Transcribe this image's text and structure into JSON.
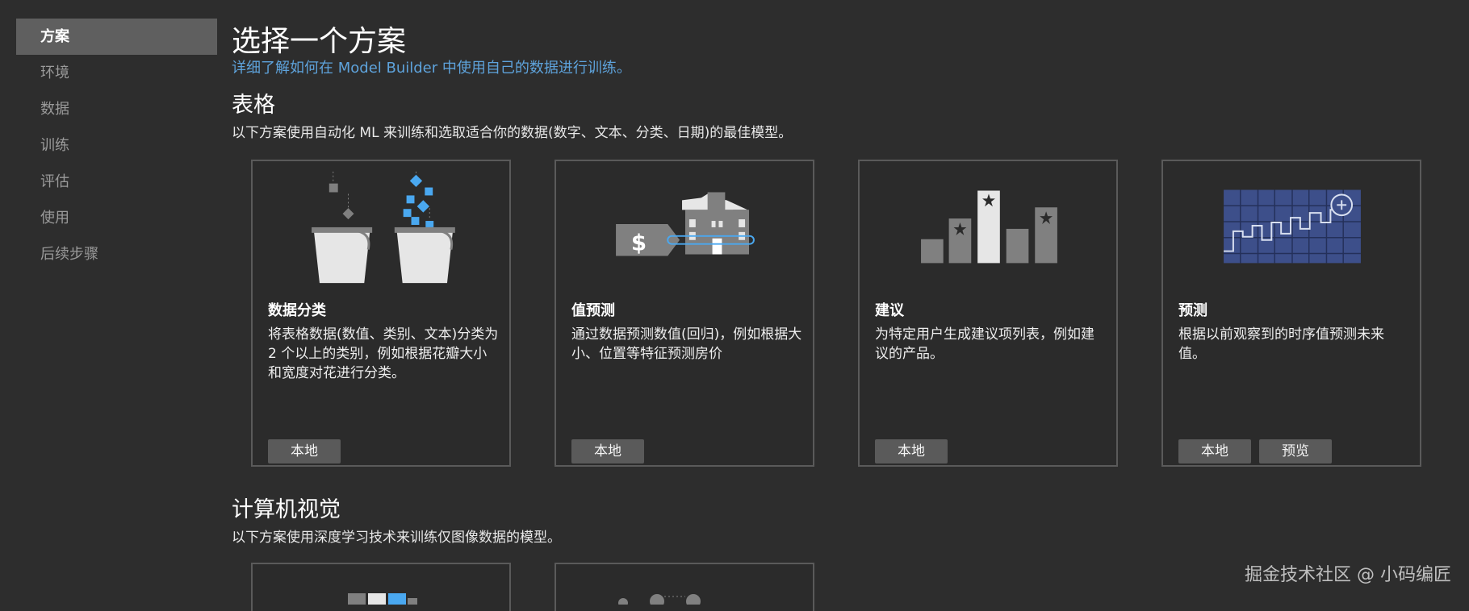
{
  "sidebar": {
    "items": [
      {
        "label": "方案",
        "active": true
      },
      {
        "label": "环境",
        "active": false
      },
      {
        "label": "数据",
        "active": false
      },
      {
        "label": "训练",
        "active": false
      },
      {
        "label": "评估",
        "active": false
      },
      {
        "label": "使用",
        "active": false
      },
      {
        "label": "后续步骤",
        "active": false
      }
    ]
  },
  "main": {
    "title": "选择一个方案",
    "learn_more_link": "详细了解如何在 Model Builder 中使用自己的数据进行训练。",
    "sections": [
      {
        "title": "表格",
        "description": "以下方案使用自动化 ML 来训练和选取适合你的数据(数字、文本、分类、日期)的最佳模型。",
        "cards": [
          {
            "title": "数据分类",
            "description": "将表格数据(数值、类别、文本)分类为 2 个以上的类别，例如根据花瓣大小和宽度对花进行分类。",
            "tags": [
              "本地"
            ]
          },
          {
            "title": "值预测",
            "description": "通过数据预测数值(回归)，例如根据大小、位置等特征预测房价",
            "tags": [
              "本地"
            ]
          },
          {
            "title": "建议",
            "description": "为特定用户生成建议项列表，例如建议的产品。",
            "tags": [
              "本地"
            ]
          },
          {
            "title": "预测",
            "description": "根据以前观察到的时序值预测未来值。",
            "tags": [
              "本地",
              "预览"
            ]
          }
        ]
      },
      {
        "title": "计算机视觉",
        "description": "以下方案使用深度学习技术来训练仅图像数据的模型。"
      }
    ]
  },
  "illustration_colors": {
    "gray": "#808080",
    "light": "#e6e6e6",
    "accent_blue": "#4aa8f0",
    "chart_blue": "#3d4f8a"
  },
  "watermark": "掘金技术社区 @ 小码编匠"
}
